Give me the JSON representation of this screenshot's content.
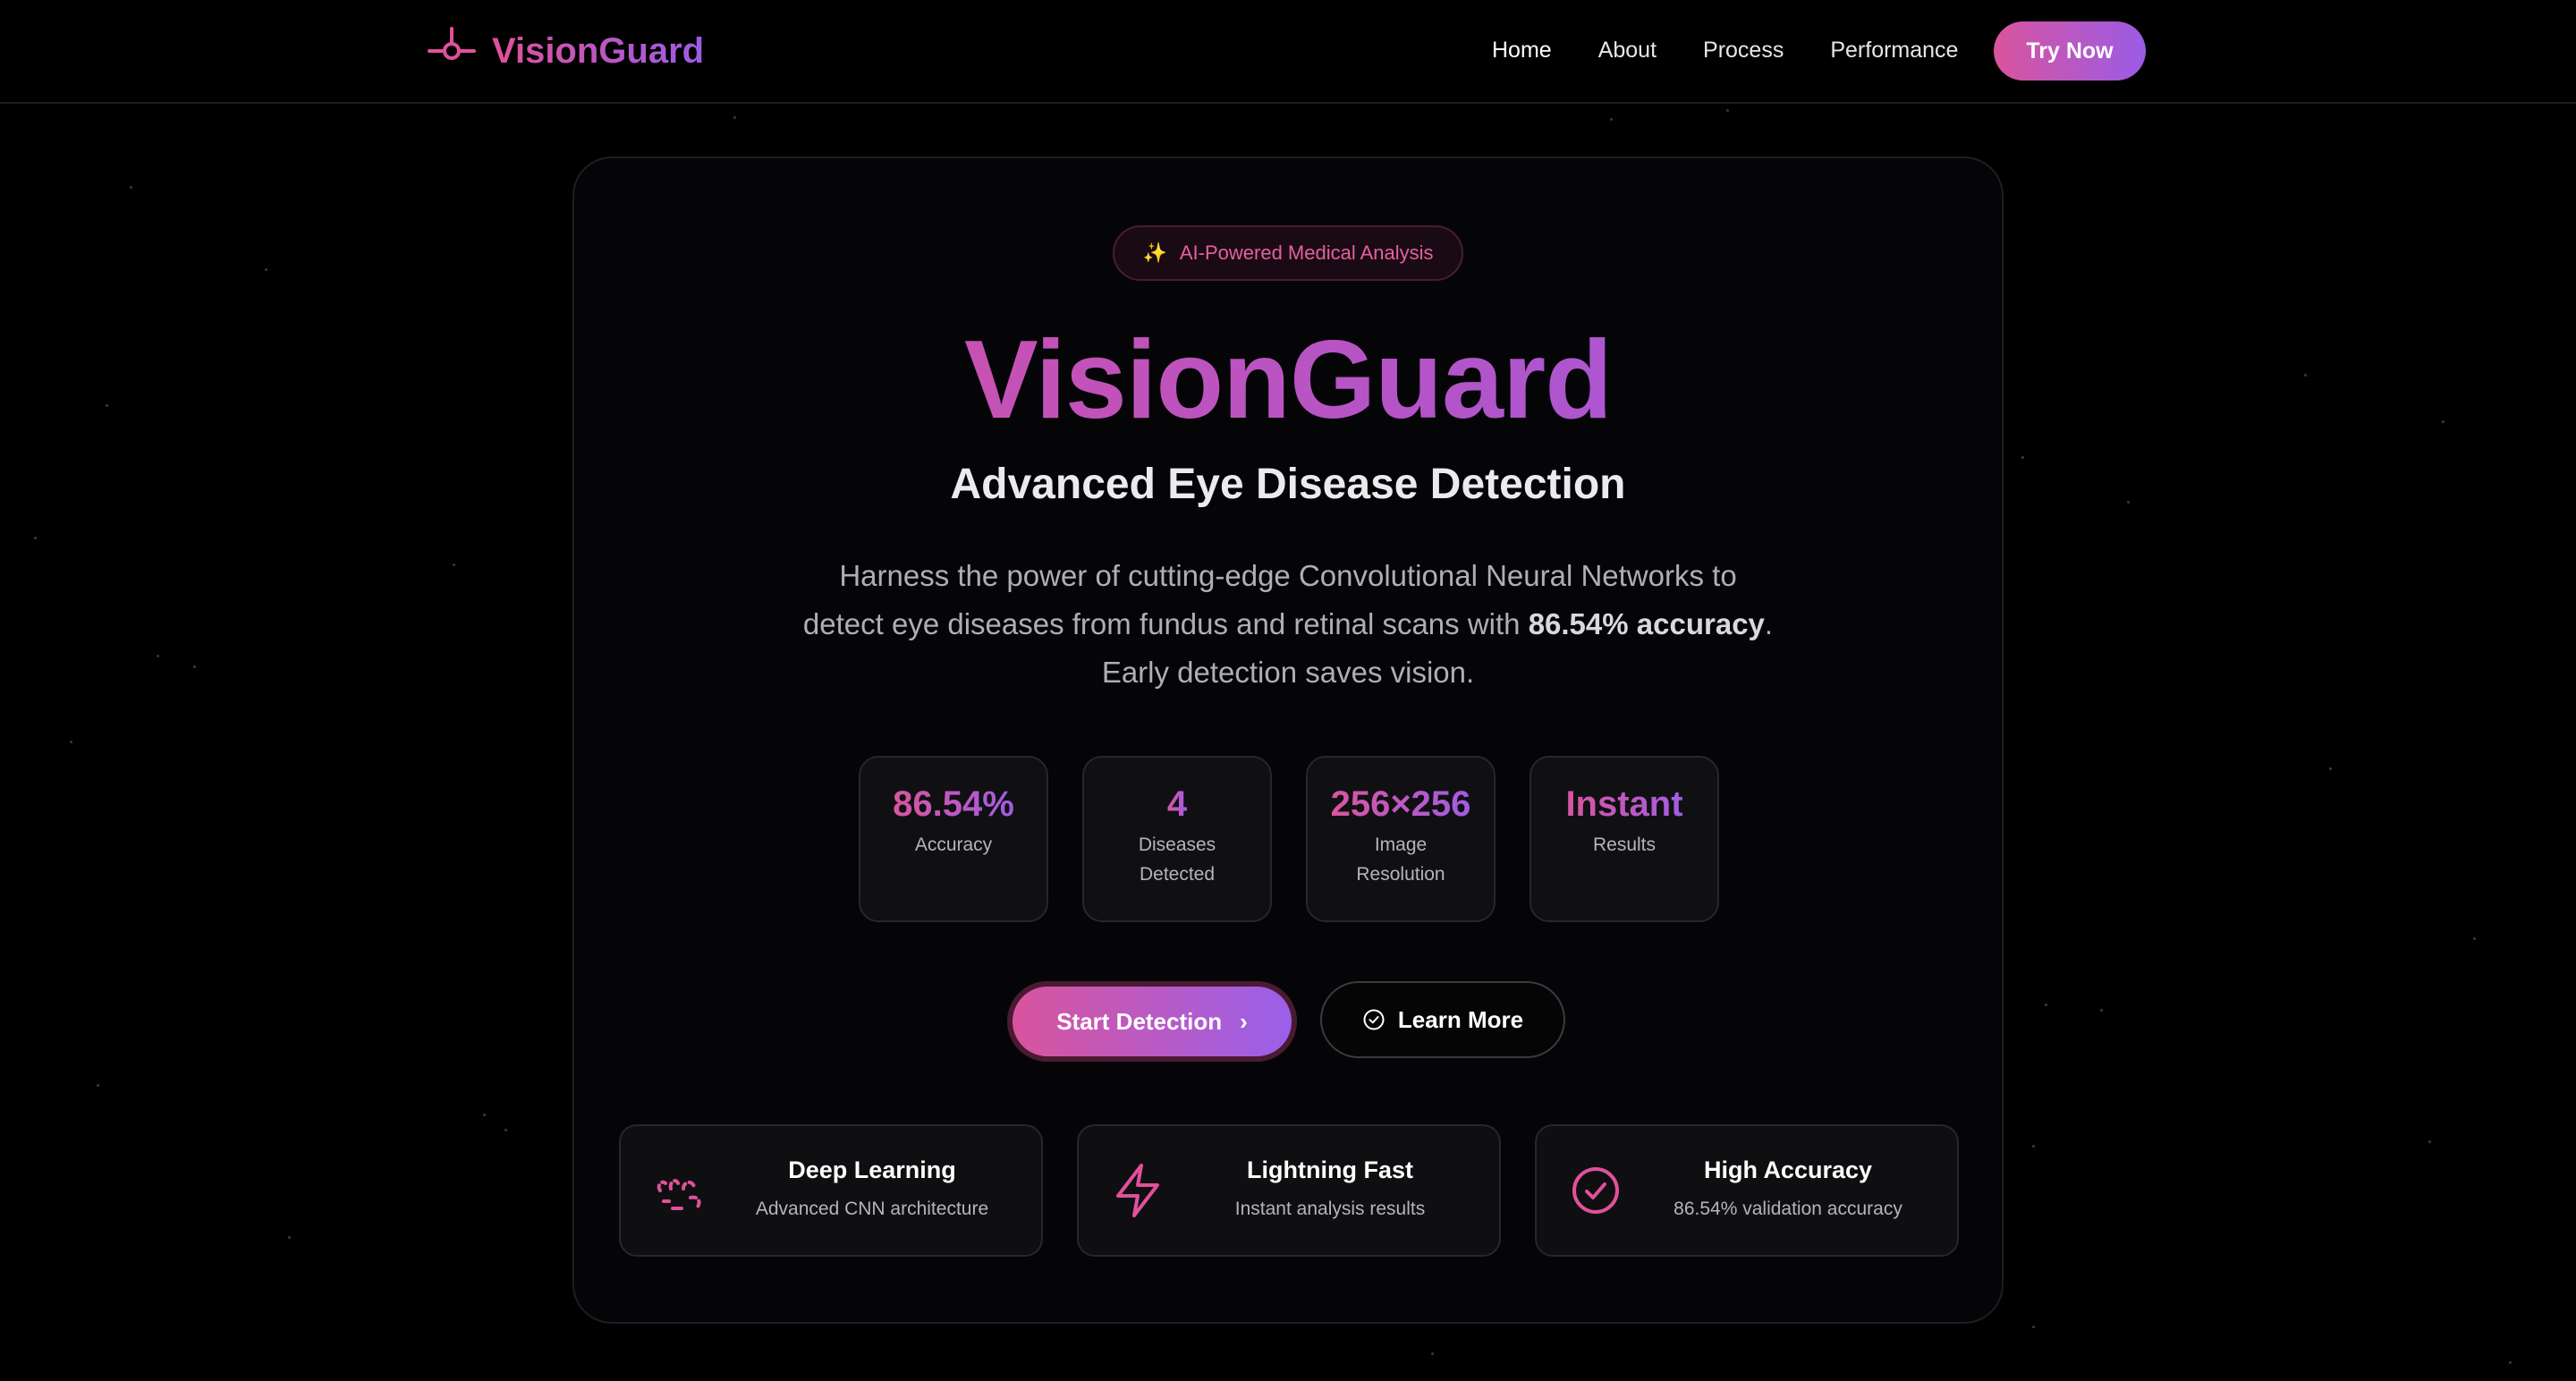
{
  "nav": {
    "brand": "VisionGuard",
    "links": [
      "Home",
      "About",
      "Process",
      "Performance"
    ],
    "cta": "Try Now"
  },
  "hero": {
    "badge": "AI-Powered Medical Analysis",
    "title": "VisionGuard",
    "subtitle": "Advanced Eye Disease Detection",
    "description": {
      "part1": "Harness the power of cutting-edge Convolutional Neural Networks to detect eye diseases from fundus and retinal scans with ",
      "bold1": "86.54% accuracy",
      "part2": ". Early detection saves vision."
    }
  },
  "stats": [
    {
      "value": "86.54%",
      "label": "Accuracy"
    },
    {
      "value": "4",
      "label": "Diseases Detected"
    },
    {
      "value": "256×256",
      "label": "Image Resolution"
    },
    {
      "value": "Instant",
      "label": "Results"
    }
  ],
  "buttons": {
    "start": "Start Detection",
    "learn": "Learn More"
  },
  "features": [
    {
      "icon": "brain-icon",
      "title": "Deep Learning",
      "desc": "Advanced CNN architecture"
    },
    {
      "icon": "lightning-icon",
      "title": "Lightning Fast",
      "desc": "Instant analysis results"
    },
    {
      "icon": "check-circle-icon",
      "title": "High Accuracy",
      "desc": "86.54% validation accuracy"
    }
  ],
  "colors": {
    "background": "#000000",
    "accent_pink": "#d9549d",
    "accent_purple": "#9a5ce6",
    "card_bg": "#101013"
  }
}
